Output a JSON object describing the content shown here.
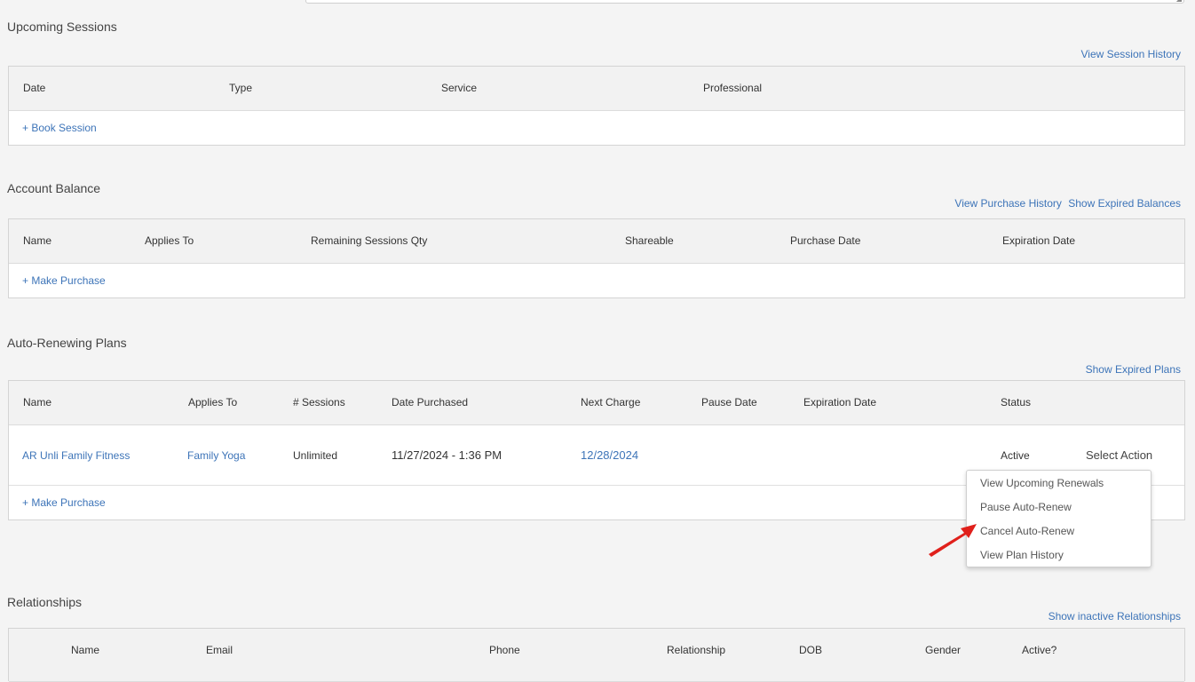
{
  "upcoming": {
    "title": "Upcoming Sessions",
    "link": "View Session History",
    "columns": [
      "Date",
      "Type",
      "Service",
      "Professional"
    ],
    "action": "+ Book Session"
  },
  "balance": {
    "title": "Account Balance",
    "links": [
      "View Purchase History",
      "Show Expired Balances"
    ],
    "columns": [
      "Name",
      "Applies To",
      "Remaining Sessions Qty",
      "Shareable",
      "Purchase Date",
      "Expiration Date"
    ],
    "action": "+ Make Purchase"
  },
  "plans": {
    "title": "Auto-Renewing Plans",
    "link": "Show Expired Plans",
    "columns": [
      "Name",
      "Applies To",
      "# Sessions",
      "Date Purchased",
      "Next Charge",
      "Pause Date",
      "Expiration Date",
      "Status"
    ],
    "rows": [
      {
        "name": "AR Unli Family Fitness",
        "applies_to": "Family Yoga",
        "sessions": "Unlimited",
        "date_purchased": "11/27/2024 - 1:36 PM",
        "next_charge": "12/28/2024",
        "pause_date": "",
        "expiration_date": "",
        "status": "Active",
        "select_action": "Select Action"
      }
    ],
    "action": "+ Make Purchase",
    "menu": [
      "View Upcoming Renewals",
      "Pause Auto-Renew",
      "Cancel Auto-Renew",
      "View Plan History"
    ]
  },
  "relationships": {
    "title": "Relationships",
    "link": "Show inactive Relationships",
    "columns": [
      "Name",
      "Email",
      "Phone",
      "Relationship",
      "DOB",
      "Gender",
      "Active?"
    ]
  },
  "colors": {
    "link": "#3d74b8",
    "header_bg": "#f2f2f2",
    "page_bg": "#f4f4f4",
    "annotation_arrow": "#e0201b"
  },
  "icons": {
    "resize_grip": "resize-grip-icon",
    "annotation": "red-arrow-icon"
  }
}
